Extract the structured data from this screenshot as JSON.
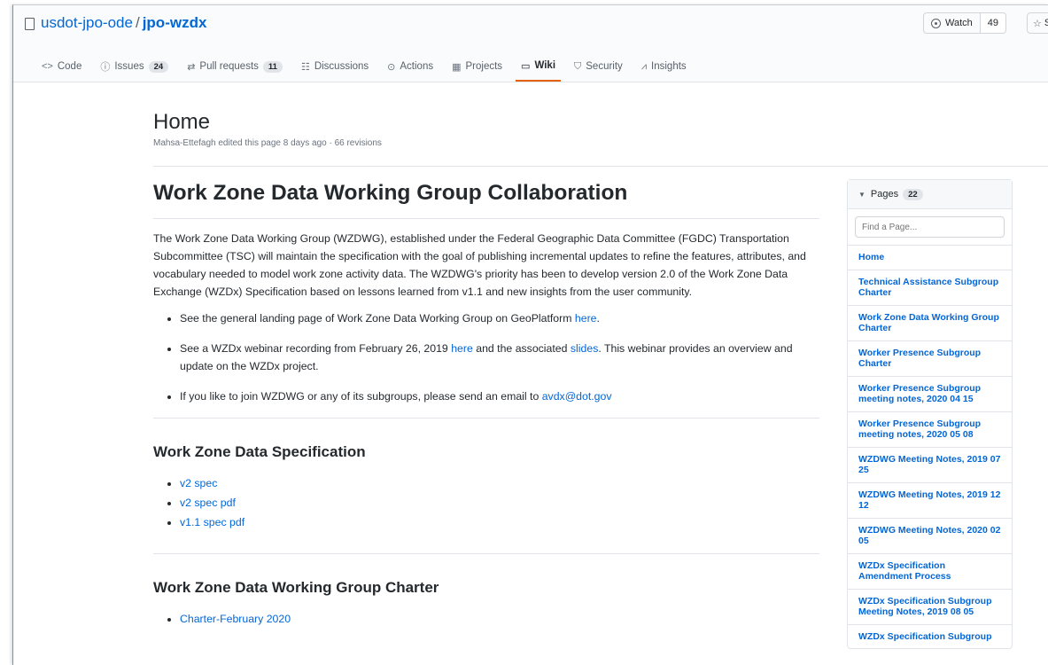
{
  "repo": {
    "owner": "usdot-jpo-ode",
    "separator": "/",
    "name": "jpo-wzdx"
  },
  "watch": {
    "label": "Watch",
    "count": "49"
  },
  "star": {
    "label": "S"
  },
  "tabs": [
    {
      "icon": "<>",
      "label": "Code",
      "count": ""
    },
    {
      "icon": "ⓘ",
      "label": "Issues",
      "count": "24"
    },
    {
      "icon": "⇄",
      "label": "Pull requests",
      "count": "11"
    },
    {
      "icon": "☷",
      "label": "Discussions",
      "count": ""
    },
    {
      "icon": "⊙",
      "label": "Actions",
      "count": ""
    },
    {
      "icon": "▦",
      "label": "Projects",
      "count": ""
    },
    {
      "icon": "▭",
      "label": "Wiki",
      "count": ""
    },
    {
      "icon": "⛉",
      "label": "Security",
      "count": ""
    },
    {
      "icon": "⩘",
      "label": "Insights",
      "count": ""
    }
  ],
  "wiki": {
    "title": "Home",
    "meta": "Mahsa-Ettefagh edited this page 8 days ago · 66 revisions"
  },
  "content": {
    "h1": "Work Zone Data Working Group Collaboration",
    "intro": "The Work Zone Data Working Group (WZDWG), established under the Federal Geographic Data Committee (FGDC) Transportation Subcommittee (TSC) will maintain the specification with the goal of publishing incremental updates to refine the features, attributes, and vocabulary needed to model work zone activity data. The WZDWG's priority has been to develop version 2.0 of the Work Zone Data Exchange (WZDx) Specification based on lessons learned from v1.1 and new insights from the user community.",
    "bullet1": {
      "text": "See the general landing page of Work Zone Data Working Group on GeoPlatform ",
      "link": "here",
      "end": "."
    },
    "bullet2": {
      "a": "See a WZDx webinar recording from February 26, 2019 ",
      "link1": "here",
      "b": " and the associated ",
      "link2": "slides",
      "c": ". This webinar provides an overview and update on the WZDx project."
    },
    "bullet3": {
      "text": "If you like to join WZDWG or any of its subgroups, please send an email to ",
      "link": "avdx@dot.gov"
    },
    "h2_spec": "Work Zone Data Specification",
    "spec_links": [
      "v2 spec",
      "v2 spec pdf",
      "v1.1 spec pdf"
    ],
    "h2_charter": "Work Zone Data Working Group Charter",
    "charter_links": [
      "Charter-February 2020"
    ]
  },
  "sidebar": {
    "label": "Pages",
    "count": "22",
    "find_placeholder": "Find a Page...",
    "pages": [
      "Home",
      "Technical Assistance Subgroup Charter",
      "Work Zone Data Working Group Charter",
      "Worker Presence Subgroup Charter",
      "Worker Presence Subgroup meeting notes, 2020 04 15",
      "Worker Presence Subgroup meeting notes, 2020 05 08",
      "WZDWG Meeting Notes, 2019 07 25",
      "WZDWG Meeting Notes, 2019 12 12",
      "WZDWG Meeting Notes, 2020 02 05",
      "WZDx Specification Amendment Process",
      "WZDx Specification Subgroup Meeting Notes, 2019 08 05",
      "WZDx Specification Subgroup"
    ]
  }
}
